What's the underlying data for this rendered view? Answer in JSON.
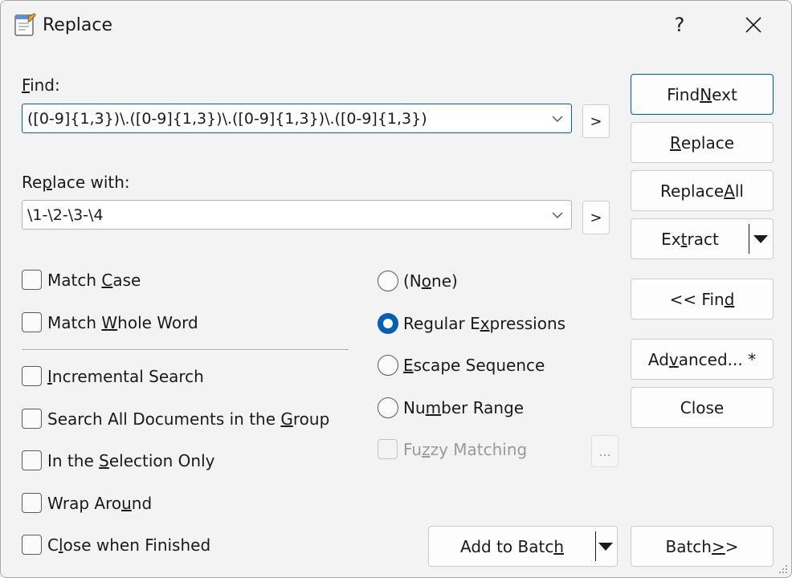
{
  "window": {
    "title": "Replace",
    "help_label": "?",
    "close_label": "✕"
  },
  "find": {
    "label_pre": "",
    "label_key": "F",
    "label_post": "ind:",
    "value": "([0-9]{1,3})\\.([0-9]{1,3})\\.([0-9]{1,3})\\.([0-9]{1,3})",
    "expand_label": ">"
  },
  "replace_with": {
    "label_pre": "Re",
    "label_key": "p",
    "label_post": "lace with:",
    "value": "\\1-\\2-\\3-\\4",
    "expand_label": ">"
  },
  "buttons": {
    "find_next": {
      "pre": "Find ",
      "key": "N",
      "post": "ext"
    },
    "replace": {
      "pre": "",
      "key": "R",
      "post": "eplace"
    },
    "replace_all": {
      "pre": "Replace ",
      "key": "A",
      "post": "ll"
    },
    "extract": {
      "pre": "Ex",
      "key": "t",
      "post": "ract"
    },
    "find_back": {
      "pre": "<< Fin",
      "key": "d",
      "post": ""
    },
    "advanced": {
      "pre": "Ad",
      "key": "v",
      "post": "anced... *"
    },
    "close": {
      "pre": "Close",
      "key": "",
      "post": ""
    },
    "add_to_batch": {
      "pre": "Add to Batc",
      "key": "h",
      "post": ""
    },
    "batch": {
      "pre": "Batch ",
      "key": ">",
      "post": ">"
    }
  },
  "options": {
    "match_case": {
      "pre": "Match ",
      "key": "C",
      "post": "ase",
      "checked": false
    },
    "match_whole_word": {
      "pre": "Match ",
      "key": "W",
      "post": "hole Word",
      "checked": false
    },
    "incremental_search": {
      "pre": "",
      "key": "I",
      "post": "ncremental Search",
      "checked": false
    },
    "search_all_docs": {
      "pre": "Search All Documents in the ",
      "key": "G",
      "post": "roup",
      "checked": false
    },
    "selection_only": {
      "pre": "In the ",
      "key": "S",
      "post": "election Only",
      "checked": false
    },
    "wrap_around": {
      "pre": "Wrap Aro",
      "key": "u",
      "post": "nd",
      "checked": false
    },
    "close_when_finished": {
      "pre": "C",
      "key": "l",
      "post": "ose when Finished",
      "checked": false
    }
  },
  "mode": {
    "none": {
      "pre": "(N",
      "key": "o",
      "post": "ne)",
      "selected": false
    },
    "regex": {
      "pre": "Regular E",
      "key": "x",
      "post": "pressions",
      "selected": true
    },
    "escape": {
      "pre": "",
      "key": "E",
      "post": "scape Sequence",
      "selected": false
    },
    "number_range": {
      "pre": "Nu",
      "key": "m",
      "post": "ber Range",
      "selected": false
    },
    "fuzzy": {
      "pre": "Fu",
      "key": "z",
      "post": "zy Matching",
      "checked": false,
      "disabled": true
    },
    "fuzzy_settings_label": "..."
  },
  "colors": {
    "accent": "#005fb8",
    "window_bg": "#f3f3f3"
  }
}
